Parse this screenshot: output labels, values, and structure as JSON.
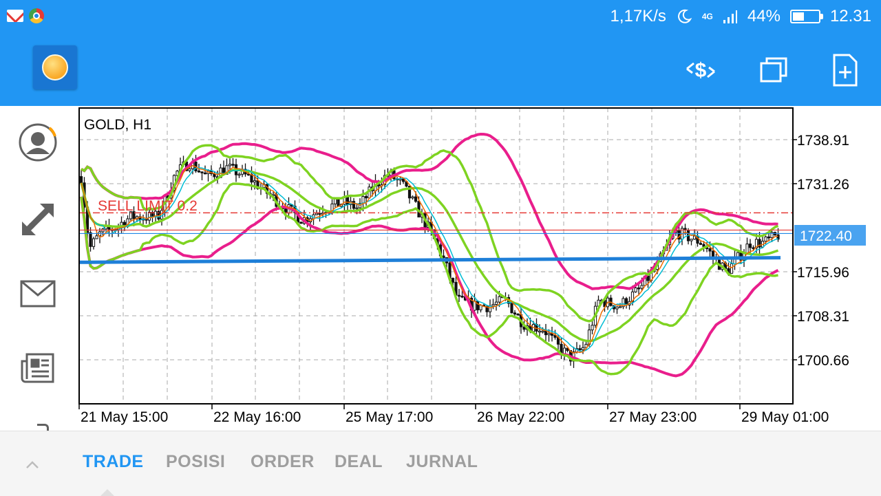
{
  "status_bar": {
    "net_speed": "1,17K/s",
    "network": "4G",
    "battery_percent": "44%",
    "battery_level": 0.44,
    "time": "12.31",
    "icons": [
      "gmail-icon",
      "chrome-icon",
      "moon-icon",
      "signal-icon",
      "battery-icon"
    ]
  },
  "app_bar": {
    "icons": [
      "metatrader-logo-icon",
      "one-click-trading-icon",
      "windows-icon",
      "new-order-icon"
    ]
  },
  "sidebar": {
    "items": [
      {
        "name": "account",
        "icon": "avatar-icon"
      },
      {
        "name": "trade",
        "icon": "trade-arrows-icon"
      },
      {
        "name": "mail",
        "icon": "mail-icon"
      },
      {
        "name": "news",
        "icon": "news-icon"
      }
    ]
  },
  "chart": {
    "symbol_title": "GOLD, H1",
    "order_label": "SELL LIMIT 0.2",
    "current_price": "1722.40",
    "price_labels": [
      "1738.91",
      "1731.26",
      "1715.96",
      "1708.31",
      "1700.66"
    ],
    "time_labels": [
      "21 May 15:00",
      "22 May 16:00",
      "25 May 17:00",
      "26 May 22:00",
      "27 May 23:00",
      "29 May 01:00"
    ],
    "colors": {
      "bollinger_outer": "#e91e8c",
      "bollinger_inner": "#7ed321",
      "moving_average_long": "#1e7fd8",
      "ma_fast": "#00bcd4",
      "ma_slow": "#ef6c00",
      "sell_limit": "#e53935",
      "ask_line": "#e53935",
      "bid_line": "#1e88e5",
      "candle": "#111111",
      "price_badge": "#4aa3f0"
    }
  },
  "tabs": [
    {
      "label": "TRADE",
      "active": true
    },
    {
      "label": "POSISI",
      "active": false
    },
    {
      "label": "ORDER",
      "active": false
    },
    {
      "label": "DEAL",
      "active": false
    },
    {
      "label": "JURNAL",
      "active": false
    }
  ]
}
